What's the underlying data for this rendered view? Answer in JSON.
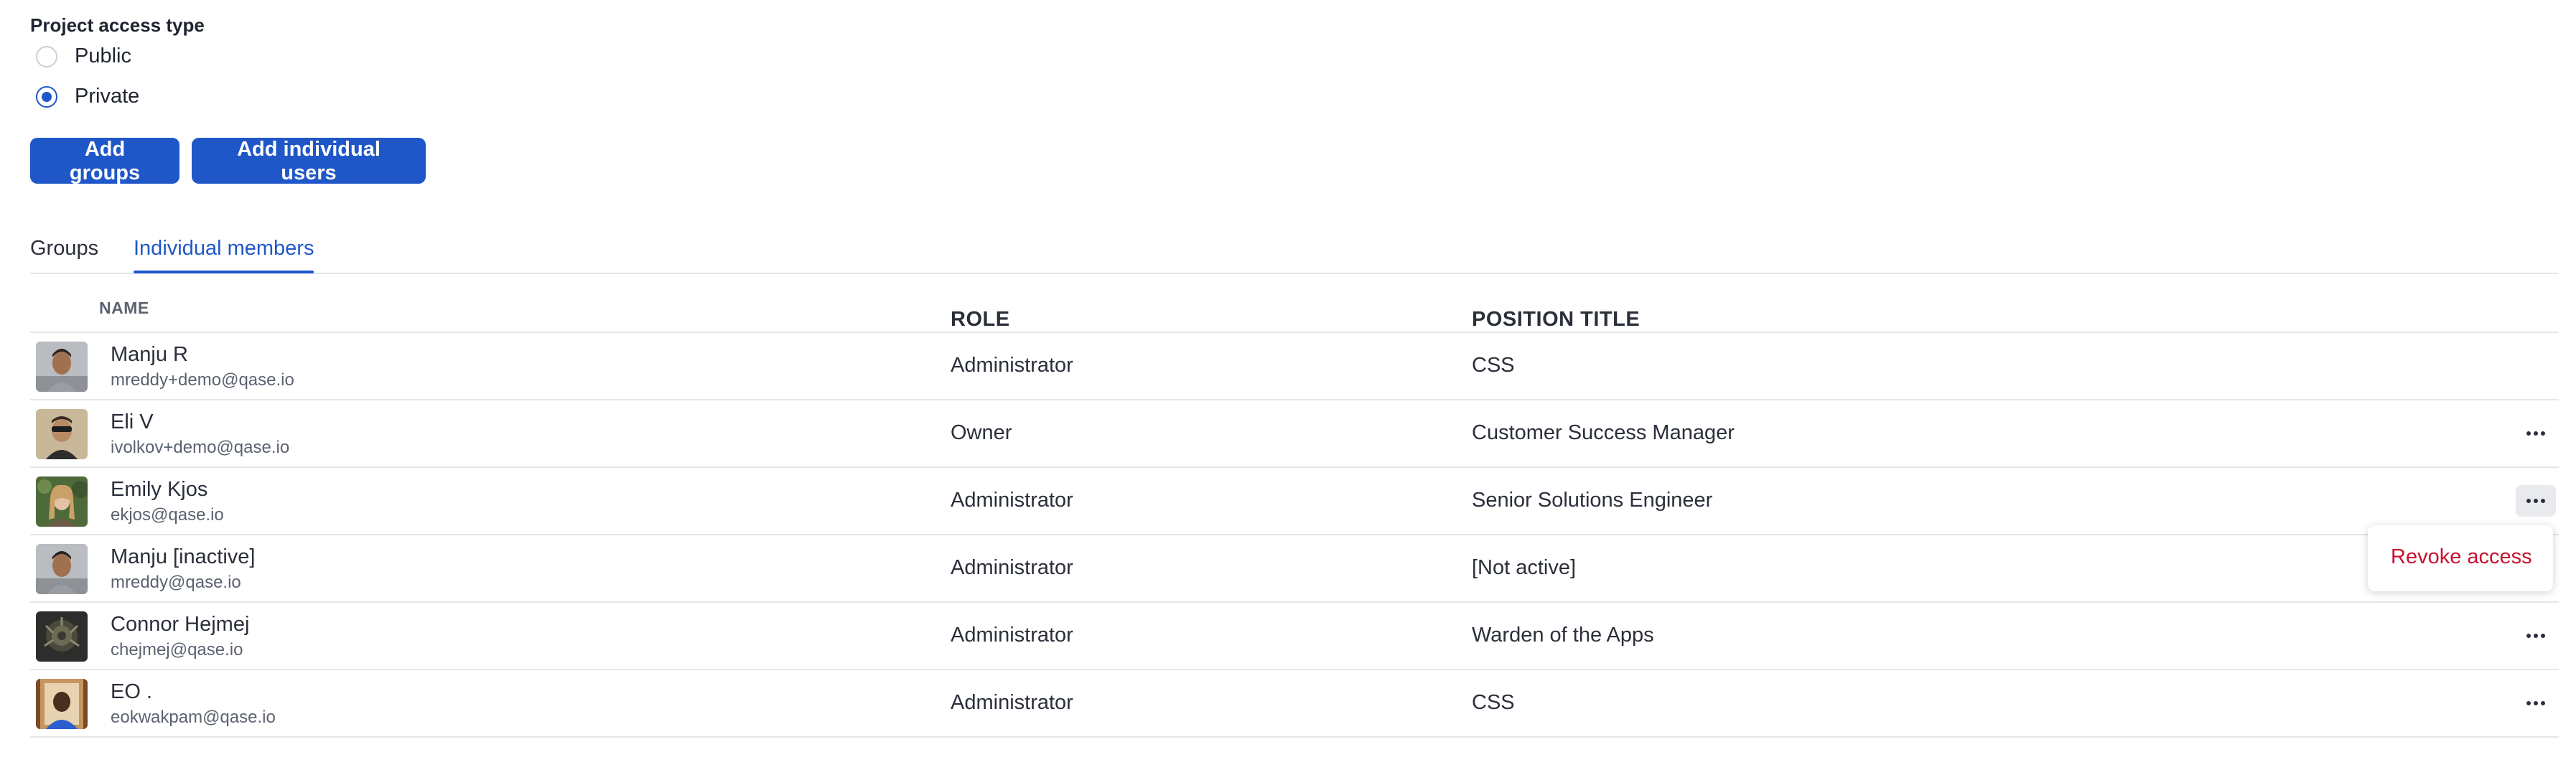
{
  "access": {
    "label": "Project access type",
    "options": [
      {
        "label": "Public",
        "checked": false
      },
      {
        "label": "Private",
        "checked": true
      }
    ]
  },
  "buttons": {
    "add_groups": "Add groups",
    "add_users": "Add individual users"
  },
  "tabs": [
    {
      "label": "Groups",
      "active": false
    },
    {
      "label": "Individual members",
      "active": true
    }
  ],
  "table": {
    "headers": {
      "name": "NAME",
      "role": "ROLE",
      "position": "POSITION TITLE"
    },
    "rows": [
      {
        "name": "Manju R",
        "email": "mreddy+demo@qase.io",
        "role": "Administrator",
        "position": "CSS",
        "has_menu": false
      },
      {
        "name": "Eli V",
        "email": "ivolkov+demo@qase.io",
        "role": "Owner",
        "position": "Customer Success Manager",
        "has_menu": true
      },
      {
        "name": "Emily Kjos",
        "email": "ekjos@qase.io",
        "role": "Administrator",
        "position": "Senior Solutions Engineer",
        "has_menu": true
      },
      {
        "name": "Manju [inactive]",
        "email": "mreddy@qase.io",
        "role": "Administrator",
        "position": "[Not active]",
        "has_menu": false
      },
      {
        "name": "Connor Hejmej",
        "email": "chejmej@qase.io",
        "role": "Administrator",
        "position": "Warden of the Apps",
        "has_menu": true
      },
      {
        "name": "EO .",
        "email": "eokwakpam@qase.io",
        "role": "Administrator",
        "position": "CSS",
        "has_menu": true
      }
    ]
  },
  "menu": {
    "revoke_label": "Revoke access"
  },
  "colors": {
    "accent": "#1f57c8",
    "danger": "#c8102e",
    "divider": "#e3e6eb"
  }
}
